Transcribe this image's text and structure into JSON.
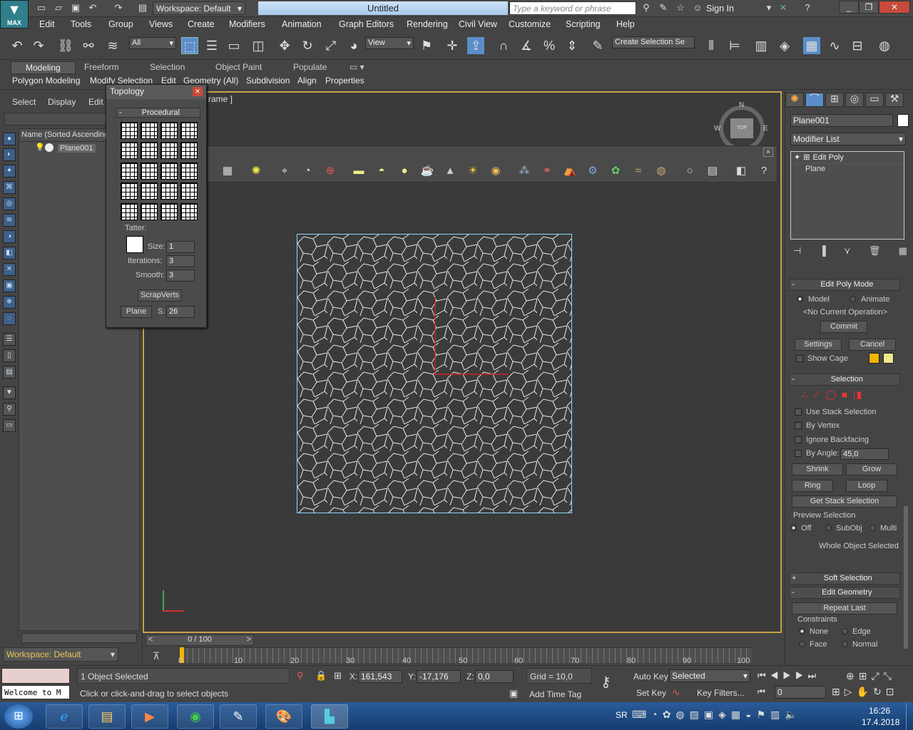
{
  "app": {
    "logo": "MAX",
    "workspace": "Workspace: Default",
    "title": "Untitled",
    "search_placeholder": "Type a keyword or phrase",
    "sign_in": "Sign In"
  },
  "menu": [
    "Edit",
    "Tools",
    "Group",
    "Views",
    "Create",
    "Modifiers",
    "Animation",
    "Graph Editors",
    "Rendering",
    "Civil View",
    "Customize",
    "Scripting",
    "Help"
  ],
  "toolbar": {
    "filter": "All",
    "view": "View",
    "selection_set": "Create Selection Se"
  },
  "ribbon": {
    "tabs": [
      "Modeling",
      "Freeform",
      "Selection",
      "Object Paint",
      "Populate"
    ],
    "sub": [
      "Polygon Modeling",
      "Modify Selection",
      "Edit",
      "Geometry (All)",
      "Subdivision",
      "Align",
      "Properties"
    ]
  },
  "scene_explorer": {
    "tabs": [
      "Select",
      "Display",
      "Edit"
    ],
    "header": "Name (Sorted Ascending)",
    "item": "Plane001",
    "workspace": "Workspace: Default"
  },
  "viewport": {
    "label": "rame ]",
    "compass_n": "N",
    "compass_w": "W",
    "compass_e": "E",
    "cube": "TOP"
  },
  "topology": {
    "title": "Topology",
    "section": "Procedural",
    "tatter": "Tatter:",
    "size_label": "Size:",
    "size": "1",
    "iter_label": "Iterations:",
    "iter": "3",
    "smooth_label": "Smooth:",
    "smooth": "3",
    "scrapverts": "ScrapVerts",
    "plane": "Plane",
    "s_label": "S:",
    "s": "26"
  },
  "modify": {
    "object_name": "Plane001",
    "modifier_list": "Modifier List",
    "stack": [
      "Edit Poly",
      "Plane"
    ],
    "edit_poly_mode": "Edit Poly Mode",
    "model": "Model",
    "animate": "Animate",
    "no_op": "<No Current Operation>",
    "commit": "Commit",
    "settings": "Settings",
    "cancel": "Cancel",
    "show_cage": "Show Cage",
    "selection": "Selection",
    "use_stack": "Use Stack Selection",
    "by_vertex": "By Vertex",
    "ignore_back": "Ignore Backfacing",
    "by_angle": "By Angle:",
    "angle": "45,0",
    "shrink": "Shrink",
    "grow": "Grow",
    "ring": "Ring",
    "loop": "Loop",
    "get_stack": "Get Stack Selection",
    "preview": "Preview Selection",
    "off": "Off",
    "subobj": "SubObj",
    "multi": "Multi",
    "whole": "Whole Object Selected",
    "soft": "Soft Selection",
    "edit_geo": "Edit Geometry",
    "repeat": "Repeat Last",
    "constraints": "Constraints",
    "none": "None",
    "edge": "Edge",
    "face": "Face",
    "normal": "Normal"
  },
  "timeline": {
    "frame": "0 / 100",
    "ticks": [
      "0",
      "10",
      "20",
      "30",
      "40",
      "50",
      "60",
      "70",
      "80",
      "90",
      "100"
    ]
  },
  "status": {
    "selected": "1 Object Selected",
    "prompt": "Click or click-and-drag to select objects",
    "welcome": "Welcome to M",
    "x": "161,543",
    "y": "-17,176",
    "z": "0,0",
    "grid": "Grid = 10,0",
    "add_tag": "Add Time Tag",
    "auto_key": "Auto Key",
    "set_key": "Set Key",
    "selected_combo": "Selected",
    "key_filters": "Key Filters...",
    "frame": "0",
    "x_label": "X:",
    "y_label": "Y:",
    "z_label": "Z:"
  },
  "taskbar": {
    "lang": "SR",
    "time": "16:26",
    "date": "17.4.2018"
  }
}
